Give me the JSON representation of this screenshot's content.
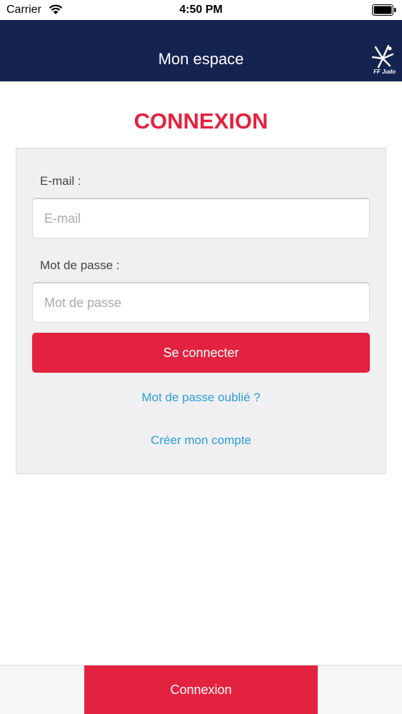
{
  "status_bar": {
    "carrier": "Carrier",
    "time": "4:50 PM",
    "icons": [
      "wifi-icon",
      "battery-icon"
    ]
  },
  "nav": {
    "title": "Mon espace",
    "logo_icon": "ff-judo-logo-icon",
    "logo_text": "FF Judo"
  },
  "page": {
    "title": "CONNEXION"
  },
  "form": {
    "email_label": "E-mail :",
    "email_placeholder": "E-mail",
    "email_value": "",
    "password_label": "Mot de passe :",
    "password_placeholder": "Mot de passe",
    "password_value": "",
    "submit_label": "Se connecter",
    "forgot_password_link": "Mot de passe oublié ?",
    "create_account_link": "Créer mon compte"
  },
  "bottom_bar": {
    "tab_label": "Connexion"
  },
  "colors": {
    "nav_background": "#152350",
    "accent_red": "#e3223f",
    "link_blue": "#2d9fd8",
    "panel_background": "#f0f0f2"
  }
}
